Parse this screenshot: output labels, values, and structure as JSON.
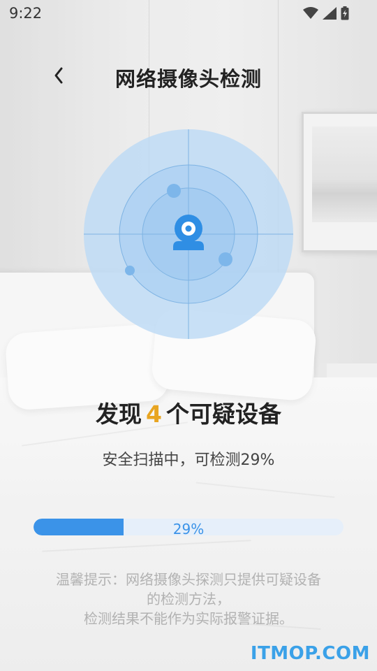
{
  "status_bar": {
    "time": "9:22"
  },
  "header": {
    "title": "网络摄像头检测",
    "back_icon": "chevron-left-icon"
  },
  "radar": {
    "center_icon": "webcam-icon",
    "accent_color": "#3b93e8"
  },
  "result": {
    "prefix": "发现",
    "count": "4",
    "suffix": "个可疑设备",
    "count_color": "#e8a521"
  },
  "scan": {
    "status_text": "安全扫描中，可检测29%",
    "progress_value": 0.29,
    "progress_label": "29%"
  },
  "tip": {
    "line1": "温馨提示：网络摄像头探测只提供可疑设备",
    "line2": "的检测方法，",
    "line3": "检测结果不能作为实际报警证据。"
  },
  "watermark": {
    "text": "ITMOP.COM"
  }
}
